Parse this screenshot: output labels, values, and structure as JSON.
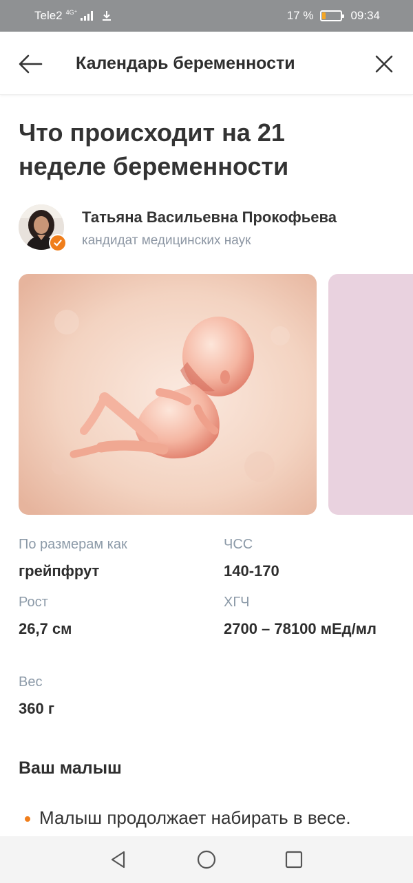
{
  "status_bar": {
    "carrier": "Tele2",
    "network": "4G⁺",
    "battery": "17 %",
    "battery_level": 0.17,
    "time": "09:34"
  },
  "header": {
    "title": "Календарь беременности",
    "back_icon": "arrow-left-icon",
    "close_icon": "close-icon"
  },
  "article": {
    "title": "Что происходит на 21 неделе беременности",
    "author": {
      "name": "Татьяна Васильевна Прокофьева",
      "degree": "кандидат медицинских наук"
    }
  },
  "stats": {
    "size_label": "По размерам как",
    "size_value": "грейпфрут",
    "height_label": "Рост",
    "height_value": "26,7 см",
    "weight_label": "Вес",
    "weight_value": "360 г",
    "hr_label": "ЧСС",
    "hr_value": "140-170",
    "hcg_label": "ХГЧ",
    "hcg_value": "2700 – 78100 мЕд/мл"
  },
  "section": {
    "title": "Ваш малыш",
    "bullets": [
      "Малыш продолжает набирать в весе."
    ]
  },
  "colors": {
    "accent": "#f07e1b",
    "status_bar": "#8f9193",
    "label": "#8c9aa8"
  }
}
